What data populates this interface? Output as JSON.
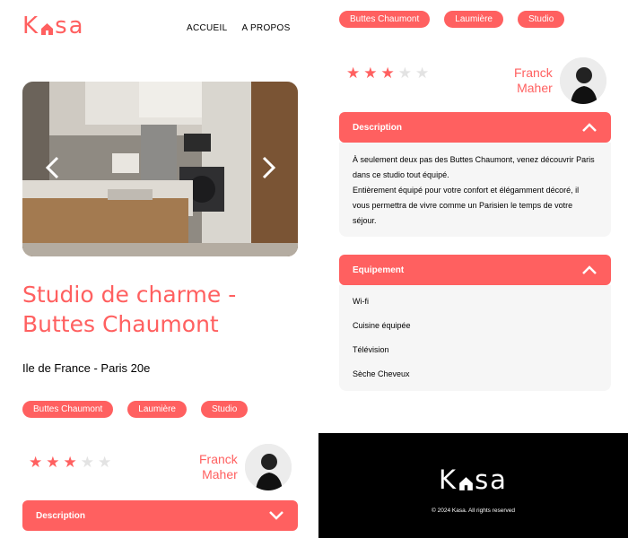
{
  "brand": {
    "logo_k": "K",
    "logo_rest": "sa",
    "color": "#FF6060"
  },
  "nav": {
    "home": "ACCUEIL",
    "about": "A PROPOS"
  },
  "listing": {
    "title": "Studio de charme - Buttes Chaumont",
    "location": "Ile de France - Paris 20e",
    "tags": [
      "Buttes Chaumont",
      "Laumière",
      "Studio"
    ],
    "rating": 3,
    "rating_max": 5,
    "host_first": "Franck",
    "host_last": "Maher"
  },
  "gallery": {
    "prev_icon": "chevron-left-icon",
    "next_icon": "chevron-right-icon"
  },
  "description": {
    "label": "Description",
    "paragraphs": [
      "À seulement deux pas des Buttes Chaumont, venez découvrir Paris dans ce studio tout équipé.",
      "Entièrement équipé pour votre confort et élégamment décoré, il vous permettra de vivre comme un Parisien le temps de votre séjour."
    ]
  },
  "equipment": {
    "label": "Equipement",
    "items": [
      "Wi-fi",
      "Cuisine équipée",
      "Télévision",
      "Sèche Cheveux"
    ]
  },
  "footer": {
    "copyright": "© 2024 Kasa. All rights reserved"
  },
  "colors": {
    "accent": "#FF6060",
    "panel": "#F6F6F6",
    "star_off": "#E3E3E3"
  }
}
